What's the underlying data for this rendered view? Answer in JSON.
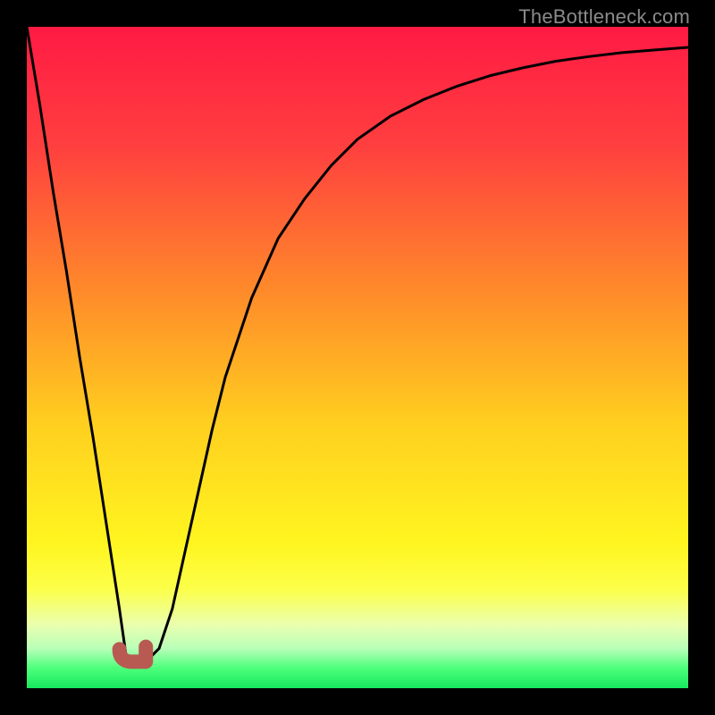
{
  "watermark": "TheBottleneck.com",
  "chart_data": {
    "type": "line",
    "title": "",
    "xlabel": "",
    "ylabel": "",
    "xlim": [
      0,
      100
    ],
    "ylim": [
      0,
      100
    ],
    "x": [
      0,
      2,
      4,
      6,
      8,
      10,
      12,
      14,
      15,
      16,
      18,
      20,
      22,
      24,
      26,
      28,
      30,
      34,
      38,
      42,
      46,
      50,
      55,
      60,
      65,
      70,
      75,
      80,
      85,
      90,
      95,
      100
    ],
    "y": [
      100,
      88,
      75,
      63,
      50,
      38,
      25,
      12,
      5,
      4,
      4,
      6,
      12,
      21,
      30,
      39,
      47,
      59,
      68,
      74,
      79,
      83,
      86.5,
      89,
      91,
      92.6,
      93.8,
      94.8,
      95.5,
      96.1,
      96.5,
      96.9
    ],
    "minimum_marker": {
      "x_range": [
        14,
        18
      ],
      "y": 4,
      "color": "#b85a52"
    },
    "gradient_stops": [
      {
        "pos": 0.0,
        "color": "#ff1a44"
      },
      {
        "pos": 0.18,
        "color": "#ff3f3f"
      },
      {
        "pos": 0.4,
        "color": "#ff8a2a"
      },
      {
        "pos": 0.6,
        "color": "#ffcf1f"
      },
      {
        "pos": 0.78,
        "color": "#fff51f"
      },
      {
        "pos": 0.85,
        "color": "#fcff49"
      },
      {
        "pos": 0.905,
        "color": "#eaffb0"
      },
      {
        "pos": 0.94,
        "color": "#b8ffb8"
      },
      {
        "pos": 0.97,
        "color": "#4cff7a"
      },
      {
        "pos": 1.0,
        "color": "#16e85e"
      }
    ],
    "line_color": "#000000",
    "grid": false,
    "legend": false
  }
}
